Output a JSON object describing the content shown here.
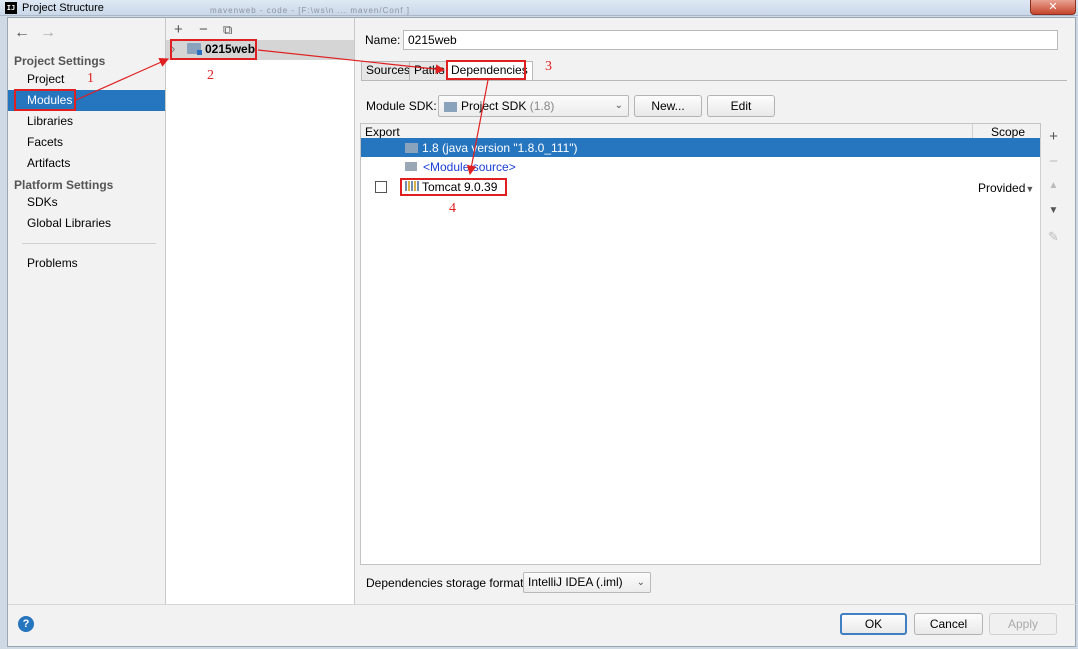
{
  "window": {
    "title": "Project Structure",
    "app_icon_text": "IJ",
    "close_label": "✕",
    "background_text": "mavenweb  -  code  -  [F:\\ws\\n ...  maven/Conf ]"
  },
  "nav": {
    "back_icon": "←",
    "forward_icon": "→",
    "project_settings_title": "Project Settings",
    "project_settings_items": [
      "Project",
      "Modules",
      "Libraries",
      "Facets",
      "Artifacts"
    ],
    "selected_item": "Modules",
    "platform_settings_title": "Platform Settings",
    "platform_settings_items": [
      "SDKs",
      "Global Libraries"
    ],
    "problems": "Problems"
  },
  "module_list": {
    "add_icon": "+",
    "remove_icon": "−",
    "copy_icon": "⧉",
    "expand_icon": "›",
    "module_name": "0215web"
  },
  "detail": {
    "name_label": "Name:",
    "name_value": "0215web",
    "tabs": [
      "Sources",
      "Paths",
      "Dependencies"
    ],
    "active_tab": "Dependencies",
    "sdk_label": "Module SDK:",
    "sdk_value": "Project SDK",
    "sdk_version": "(1.8)",
    "new_button": "New...",
    "edit_button": "Edit",
    "table": {
      "col_export": "Export",
      "col_scope": "Scope",
      "rows": [
        {
          "label": "1.8 (java version \"1.8.0_111\")",
          "scope": "",
          "checkbox": false,
          "selected": true
        },
        {
          "label": "<Module source>",
          "scope": "",
          "checkbox": false,
          "selected": false
        },
        {
          "label": "Tomcat 9.0.39",
          "scope": "Provided",
          "checkbox": true,
          "checked": false,
          "selected": false
        }
      ]
    },
    "side_tools": [
      "+",
      "−",
      "▲",
      "▼",
      "✎"
    ],
    "storage_label": "Dependencies storage format:",
    "storage_value": "IntelliJ IDEA (.iml)"
  },
  "footer": {
    "help_icon": "?",
    "ok": "OK",
    "cancel": "Cancel",
    "apply": "Apply"
  },
  "annotations": [
    "1",
    "2",
    "3",
    "4"
  ],
  "colors": {
    "selection": "#2675bf",
    "annotation": "#e02020",
    "link_blue": "#1a3fd6"
  }
}
